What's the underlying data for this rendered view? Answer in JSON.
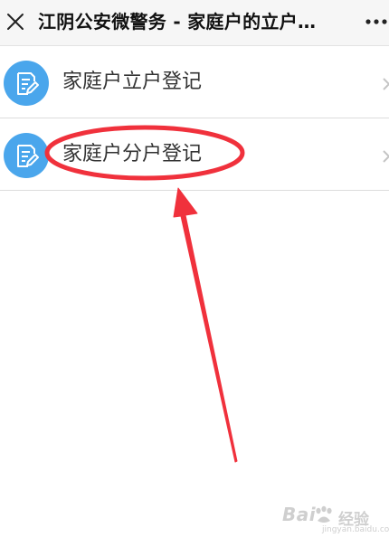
{
  "header": {
    "title": "江阴公安微警务 - 家庭户的立户…",
    "close_icon": "close-icon",
    "more_icon": "more-icon"
  },
  "list": {
    "items": [
      {
        "label": "家庭户立户登记",
        "icon": "form-edit-icon"
      },
      {
        "label": "家庭户分户登记",
        "icon": "form-edit-icon"
      }
    ]
  },
  "annotation": {
    "color": "#f0313c",
    "highlighted_item": "家庭户分户登记"
  },
  "watermark": {
    "brand": "Bai",
    "brand_suffix": "经验",
    "url": "jingyan.baidu.com"
  },
  "colors": {
    "icon_bg": "#4aa6ec",
    "topbar_bg": "#f6f6f6",
    "label_text": "#333333"
  }
}
